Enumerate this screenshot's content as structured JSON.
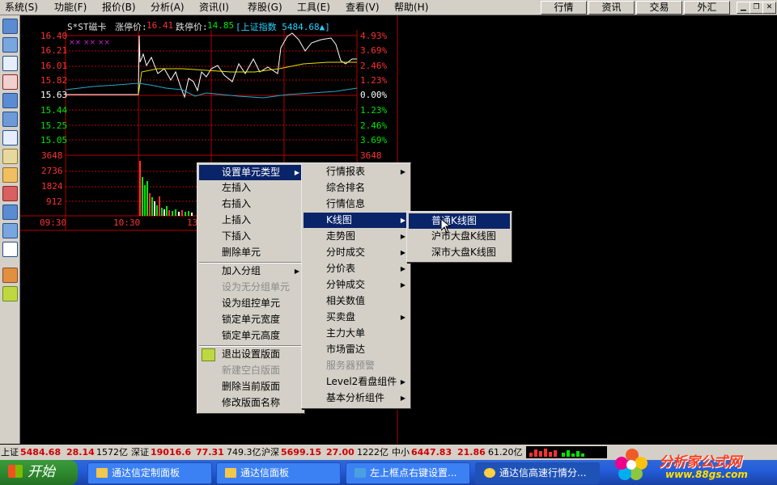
{
  "menubar": {
    "items": [
      "系统(S)",
      "功能(F)",
      "报价(B)",
      "分析(A)",
      "资讯(I)",
      "荐股(G)",
      "工具(E)",
      "查看(V)",
      "帮助(H)"
    ],
    "buttons": [
      "行情",
      "资讯",
      "交易",
      "外汇"
    ]
  },
  "chart": {
    "title": "S*ST磁卡",
    "limit_up_label": "涨停价:",
    "limit_up": "16.41",
    "limit_down_label": "跌停价:",
    "limit_down": "14.85",
    "index_label": "[上证指数 5484.68▲]",
    "price_ticks": [
      "16.40",
      "16.21",
      "16.01",
      "15.82",
      "15.63",
      "15.44",
      "15.25",
      "15.05"
    ],
    "pct_ticks": [
      "4.93%",
      "3.69%",
      "2.46%",
      "1.23%",
      "0.00%",
      "1.23%",
      "2.46%",
      "3.69%"
    ],
    "vol_ticks": [
      "3648",
      "2736",
      "1824",
      "912"
    ],
    "vol_right_top": "3648",
    "time_ticks": [
      "09:30",
      "10:30",
      "13"
    ],
    "colors": {
      "up": "#ff3030",
      "down": "#00e600",
      "flat": "#ffffff",
      "grid": "#b40000"
    }
  },
  "context_menu": {
    "items": [
      {
        "label": "设置单元类型",
        "arrow": true,
        "highlight": true
      },
      {
        "label": "左插入"
      },
      {
        "label": "右插入"
      },
      {
        "label": "上插入"
      },
      {
        "label": "下插入"
      },
      {
        "label": "删除单元"
      },
      {
        "label": "加入分组",
        "arrow": true
      },
      {
        "label": "设为无分组单元",
        "disabled": true
      },
      {
        "label": "设为组控单元"
      },
      {
        "label": "锁定单元宽度"
      },
      {
        "label": "锁定单元高度"
      },
      {
        "label": "退出设置版面",
        "icon": true
      },
      {
        "label": "新建空白版面",
        "disabled": true
      },
      {
        "label": "删除当前版面"
      },
      {
        "label": "修改版面名称"
      }
    ]
  },
  "submenu1": {
    "items": [
      {
        "label": "行情报表",
        "arrow": true
      },
      {
        "label": "综合排名"
      },
      {
        "label": "行情信息"
      },
      {
        "label": "K线图",
        "arrow": true,
        "highlight": true
      },
      {
        "label": "走势图",
        "arrow": true
      },
      {
        "label": "分时成交",
        "arrow": true
      },
      {
        "label": "分价表",
        "arrow": true
      },
      {
        "label": "分钟成交",
        "arrow": true
      },
      {
        "label": "相关数值"
      },
      {
        "label": "买卖盘",
        "arrow": true
      },
      {
        "label": "主力大单"
      },
      {
        "label": "市场雷达"
      },
      {
        "label": "服务器预警",
        "disabled": true
      },
      {
        "label": "Level2看盘组件",
        "arrow": true
      },
      {
        "label": "基本分析组件",
        "arrow": true
      }
    ]
  },
  "submenu2": {
    "items": [
      {
        "label": "普通K线图",
        "highlight": true
      },
      {
        "label": "沪市大盘K线图"
      },
      {
        "label": "深市大盘K线图"
      }
    ]
  },
  "statusbar": {
    "sh_label": "上证",
    "sh_value": "5484.68",
    "sh_change": "28.14",
    "sh_amount": "1572亿",
    "sz_label": "深证",
    "sz_value": "19016.6",
    "sz_change": "77.31",
    "sz_amount": "749.3亿",
    "hs_label": "沪深",
    "hs_value": "5699.15",
    "hs_change": "27.00",
    "hs_amount": "1222亿",
    "zx_label": "中小",
    "zx_value": "6447.83",
    "zx_change": "21.86",
    "zx_amount": "61.20亿"
  },
  "taskbar": {
    "start": "开始",
    "tasks": [
      "通达信定制面板",
      "通达信面板",
      "左上框点右键设置...",
      "通达信高速行情分..."
    ],
    "logo_text": "分析家公式网",
    "logo_url": "www.88gs.com"
  }
}
